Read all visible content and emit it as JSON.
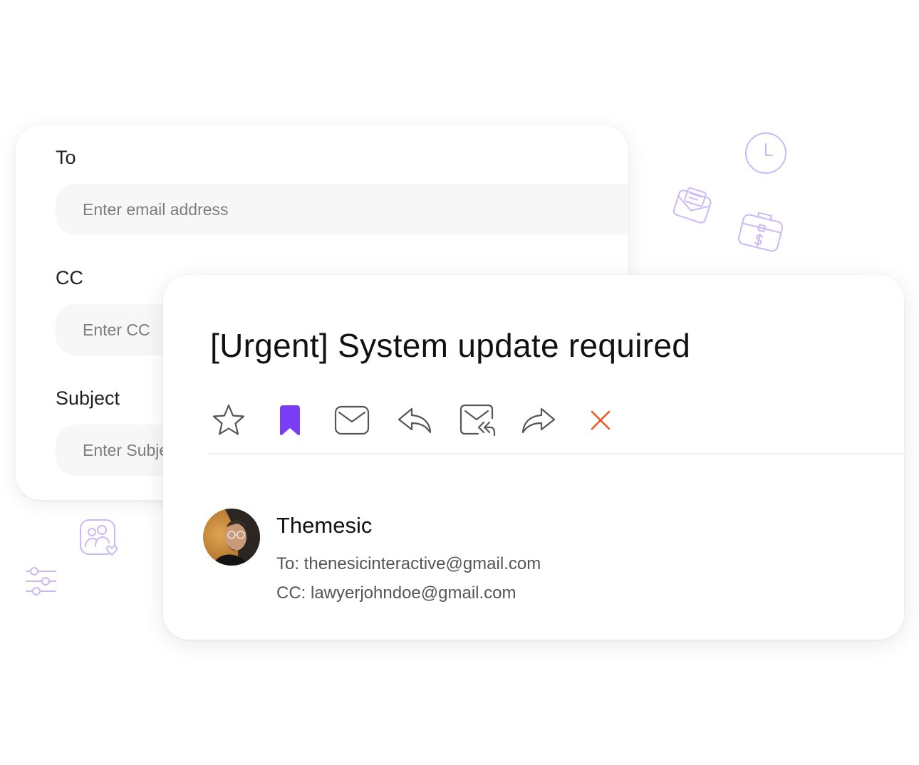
{
  "compose": {
    "to_label": "To",
    "to_placeholder": "Enter email address",
    "cc_label": "CC",
    "cc_placeholder": "Enter CC",
    "subject_label": "Subject",
    "subject_placeholder": "Enter Subject"
  },
  "email": {
    "subject": "[Urgent] System update required",
    "toolbar": [
      {
        "icon": "star-icon"
      },
      {
        "icon": "bookmark-icon",
        "active": true,
        "color": "#7b3cf5"
      },
      {
        "icon": "mail-icon"
      },
      {
        "icon": "reply-icon"
      },
      {
        "icon": "reply-all-icon"
      },
      {
        "icon": "forward-icon"
      },
      {
        "icon": "close-icon",
        "color": "#f0581f"
      }
    ],
    "sender": {
      "name": "Themesic",
      "to": "To: thenesicinteractive@gmail.com",
      "cc": "CC: lawyerjohndoe@gmail.com"
    }
  },
  "decorations": [
    "clock-icon",
    "envelope-icon",
    "briefcase-dollar-icon",
    "users-heart-icon",
    "sliders-icon"
  ],
  "colors": {
    "accent": "#7b3cf5",
    "danger": "#f0581f",
    "decor": "#c9b2f7"
  }
}
